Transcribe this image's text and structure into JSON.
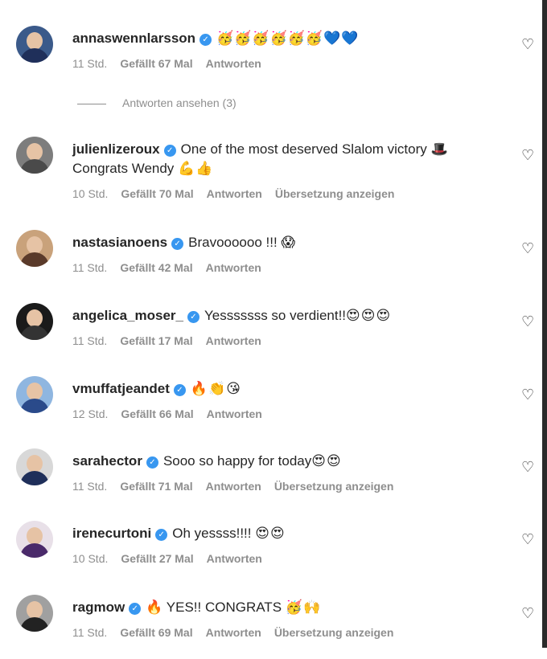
{
  "comments": [
    {
      "user": "annaswennlarsson",
      "text": "",
      "emoji": "🥳🥳🥳🥳🥳🥳💙💙",
      "time": "11 Std.",
      "likes": "Gefällt 67 Mal",
      "reply": "Antworten",
      "translate": ""
    },
    {
      "user": "julienlizeroux",
      "text": "One of the most deserved Slalom victory",
      "emoji": "🎩",
      "text2": "Congrats Wendy",
      "emoji2": "💪👍",
      "time": "10 Std.",
      "likes": "Gefällt 70 Mal",
      "reply": "Antworten",
      "translate": "Übersetzung anzeigen"
    },
    {
      "user": "nastasianoens",
      "text": "Bravoooooo !!!",
      "emoji": "😱",
      "time": "11 Std.",
      "likes": "Gefällt 42 Mal",
      "reply": "Antworten",
      "translate": ""
    },
    {
      "user": "angelica_moser_",
      "text": "Yesssssss so verdient!!",
      "emoji": "😍😍😍",
      "time": "11 Std.",
      "likes": "Gefällt 17 Mal",
      "reply": "Antworten",
      "translate": ""
    },
    {
      "user": "vmuffatjeandet",
      "text": "",
      "emoji": "🔥👏😘",
      "time": "12 Std.",
      "likes": "Gefällt 66 Mal",
      "reply": "Antworten",
      "translate": ""
    },
    {
      "user": "sarahector",
      "text": "Sooo so happy for today",
      "emoji": "😍😍",
      "time": "11 Std.",
      "likes": "Gefällt 71 Mal",
      "reply": "Antworten",
      "translate": "Übersetzung anzeigen"
    },
    {
      "user": "irenecurtoni",
      "text": "Oh yessss!!!!",
      "emoji": "😍😍",
      "time": "10 Std.",
      "likes": "Gefällt 27 Mal",
      "reply": "Antworten",
      "translate": ""
    },
    {
      "user": "ragmow",
      "text": "🔥 YES!! CONGRATS",
      "emoji": "🥳🙌",
      "time": "11 Std.",
      "likes": "Gefällt 69 Mal",
      "reply": "Antworten",
      "translate": "Übersetzung anzeigen"
    }
  ],
  "view_replies": "Antworten ansehen (3)",
  "colors": {
    "verified": "#3897f0",
    "meta": "#8e8e8e",
    "text": "#262626"
  },
  "icons": {
    "like": "heart-outline-icon",
    "verified": "verified-badge-icon"
  }
}
